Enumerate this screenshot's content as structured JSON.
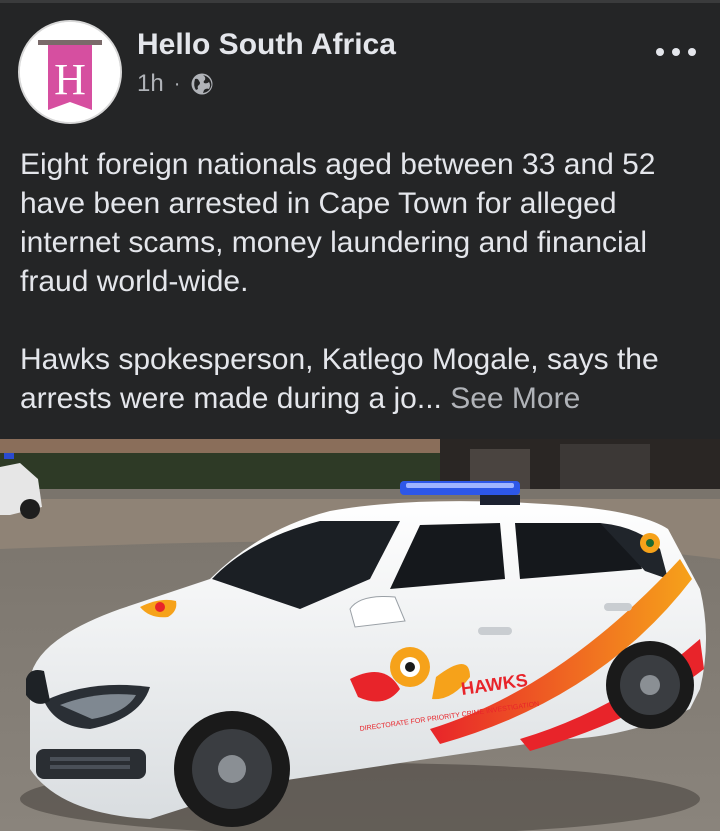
{
  "post": {
    "page_name": "Hello South Africa",
    "avatar_letter": "H",
    "time": "1h",
    "separator": "·",
    "audience_icon": "globe-icon",
    "more_icon": "more-horizontal-icon",
    "text_paragraph_1": "Eight foreign nationals aged between 33 and 52 have been arrested in Cape Town for alleged internet scams, money laundering and financial fraud world-wide.",
    "text_paragraph_2": "Hawks spokesperson, Katlego Mogale, says the arrests were made during a jo...",
    "see_more_label": "See More"
  },
  "photo": {
    "car_logo_text": "HAWKS",
    "car_subtext": "DIRECTORATE FOR PRIORITY CRIME INVESTIGATION"
  },
  "colors": {
    "background": "#242526",
    "text_primary": "#e4e6eb",
    "text_secondary": "#b0b3b8",
    "avatar_accent": "#d64fa0"
  }
}
